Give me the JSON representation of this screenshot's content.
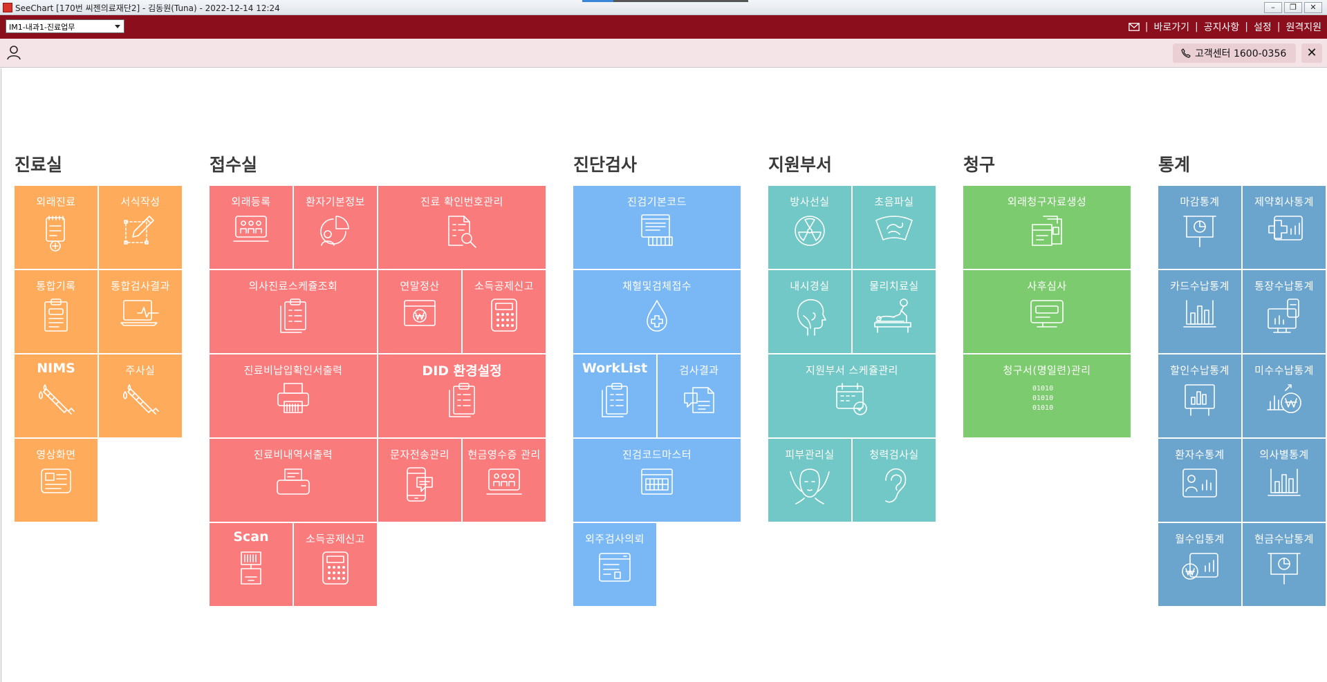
{
  "window": {
    "title": "SeeChart [170번 씨젠의료재단2] - 김동원(Tuna) - 2022-12-14 12:24",
    "minimize_glyph": "–",
    "restore_glyph": "❐",
    "close_glyph": "✕"
  },
  "menubar": {
    "dept_select": "IM1-내과1-진료업무",
    "nav": [
      "바로가기",
      "공지사항",
      "설정",
      "원격지원"
    ],
    "separator": "|"
  },
  "subbar": {
    "customer_center": "고객센터 1600-0356",
    "close_glyph": "✕"
  },
  "colors": {
    "brand_bar": "#8b0e1c",
    "orange": "#ffab5c",
    "red": "#f97b7b",
    "blue": "#79b8f4",
    "teal": "#71c8c6",
    "green": "#7ccb6e",
    "steel": "#6ba4cc"
  },
  "sections": [
    {
      "title": "진료실",
      "tiles": [
        {
          "label": "외래진료",
          "icon": "clipboard-plus-icon"
        },
        {
          "label": "서식작성",
          "icon": "pencil-edit-icon"
        },
        {
          "label": "통합기록",
          "icon": "clipboard-icon"
        },
        {
          "label": "통합검사결과",
          "icon": "monitor-pulse-icon"
        },
        {
          "label": "NIMS",
          "icon": "syringe-icon"
        },
        {
          "label": "주사실",
          "icon": "syringe-icon"
        },
        {
          "label": "영상화면",
          "icon": "image-document-icon"
        }
      ]
    },
    {
      "title": "접수실",
      "tiles": [
        {
          "label": "외래등록",
          "icon": "people-monitor-icon"
        },
        {
          "label": "환자기본정보",
          "icon": "person-pie-icon"
        },
        {
          "label": "진료 확인번호관리",
          "icon": "document-search-icon"
        },
        {
          "label": "의사진료스케쥴조회",
          "icon": "clipboard-list-icon"
        },
        {
          "label": "연말정산",
          "icon": "won-browser-icon"
        },
        {
          "label": "소득공제신고",
          "icon": "calculator-icon"
        },
        {
          "label": "진료비납입확인서출력",
          "icon": "printer-icon"
        },
        {
          "label": "DID 환경설정",
          "icon": "clipboard-list-icon"
        },
        {
          "label": "진료비내역서출력",
          "icon": "receipt-printer-icon"
        },
        {
          "label": "문자전송관리",
          "icon": "phone-message-icon"
        },
        {
          "label": "현금영수증 관리",
          "icon": "people-monitor-icon"
        },
        {
          "label": "Scan",
          "icon": "scanner-icon"
        },
        {
          "label": "소득공제신고",
          "icon": "calculator-icon"
        }
      ]
    },
    {
      "title": "진단검사",
      "tiles": [
        {
          "label": "진검기본코드",
          "icon": "keyboard-document-icon"
        },
        {
          "label": "채혈및검체접수",
          "icon": "blood-drop-icon"
        },
        {
          "label": "WorkList",
          "icon": "clipboard-list-icon"
        },
        {
          "label": "검사결과",
          "icon": "documents-chat-icon"
        },
        {
          "label": "진검코드마스터",
          "icon": "keyboard-icon"
        },
        {
          "label": "외주검사의뢰",
          "icon": "browser-list-icon"
        }
      ]
    },
    {
      "title": "지원부서",
      "tiles": [
        {
          "label": "방사선실",
          "icon": "radiation-icon"
        },
        {
          "label": "초음파실",
          "icon": "ultrasound-icon"
        },
        {
          "label": "내시경실",
          "icon": "head-profile-icon"
        },
        {
          "label": "물리치료실",
          "icon": "physio-therapy-icon"
        },
        {
          "label": "지원부서 스케쥴관리",
          "icon": "calendar-check-icon"
        },
        {
          "label": "피부관리실",
          "icon": "face-icon"
        },
        {
          "label": "청력검사실",
          "icon": "ear-icon"
        }
      ]
    },
    {
      "title": "청구",
      "tiles": [
        {
          "label": "외래청구자료생성",
          "icon": "stack-documents-icon"
        },
        {
          "label": "사후심사",
          "icon": "monitor-icon"
        },
        {
          "label": "청구서(명일련)관리",
          "icon": "binary-icon",
          "binary": [
            "01010",
            "01010",
            "01010"
          ]
        }
      ]
    },
    {
      "title": "통계",
      "tiles": [
        {
          "label": "마감통계",
          "icon": "presentation-chart-icon"
        },
        {
          "label": "제약회사통계",
          "icon": "medical-chart-icon"
        },
        {
          "label": "카드수납통계",
          "icon": "bar-chart-icon"
        },
        {
          "label": "통장수납통계",
          "icon": "phone-chart-icon"
        },
        {
          "label": "할인수납통계",
          "icon": "board-chart-icon"
        },
        {
          "label": "미수수납통계",
          "icon": "won-chart-icon"
        },
        {
          "label": "환자수통계",
          "icon": "person-chart-icon"
        },
        {
          "label": "의사별통계",
          "icon": "bar-chart-icon"
        },
        {
          "label": "월수입통계",
          "icon": "won-chart-icon"
        },
        {
          "label": "현금수납통계",
          "icon": "presentation-chart-icon"
        }
      ]
    }
  ]
}
